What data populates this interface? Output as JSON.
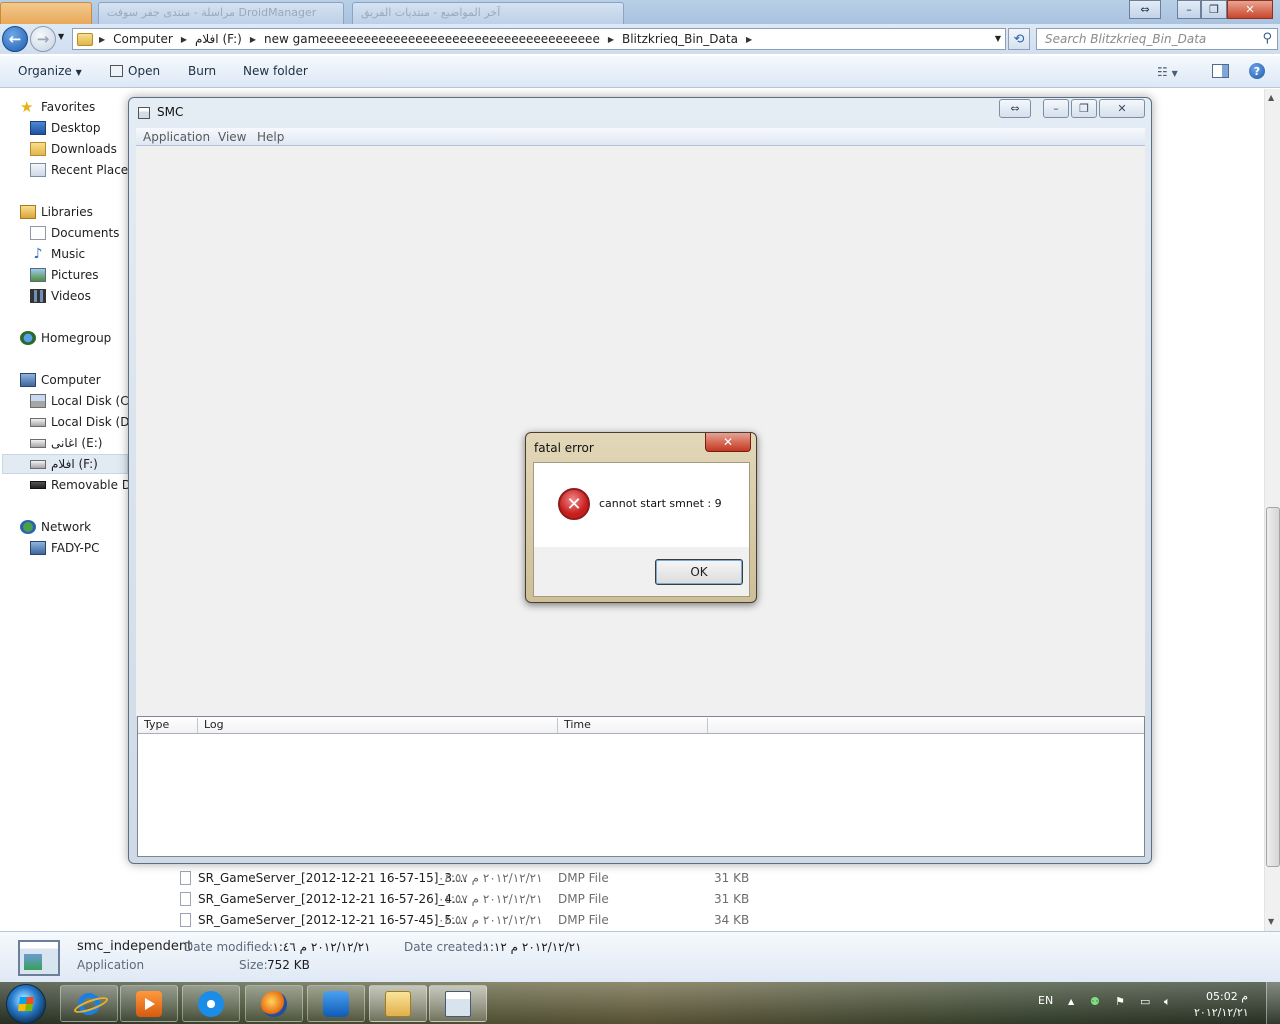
{
  "explorer": {
    "background_tabs": [
      "",
      "مراسلة - منتدى جفر سوفت DroidManager",
      "آخر المواضيع - منتديات الفريق"
    ],
    "address": {
      "segments": [
        "Computer",
        "افلام (F:)",
        "new gameeeeeeeeeeeeeeeeeeeeeeeeeeeeeeeeeeeeee",
        "Blitzkrieq_Bin_Data"
      ]
    },
    "search_placeholder": "Search Blitzkrieq_Bin_Data",
    "toolbar": {
      "organize": "Organize",
      "open": "Open",
      "burn": "Burn",
      "new_folder": "New folder"
    },
    "nav": {
      "favorites": "Favorites",
      "desktop": "Desktop",
      "downloads": "Downloads",
      "recent_places": "Recent Places",
      "libraries": "Libraries",
      "documents": "Documents",
      "music": "Music",
      "pictures": "Pictures",
      "videos": "Videos",
      "homegroup": "Homegroup",
      "computer": "Computer",
      "local_c": "Local Disk (C:)",
      "local_d": "Local Disk (D:)",
      "drive_e": "اغانى (E:)",
      "drive_f": "افلام (F:)",
      "removable": "Removable Disk",
      "network": "Network",
      "fady_pc": "FADY-PC"
    },
    "files": [
      {
        "name": "SR_GameServer_[2012-12-21 16-57-15]_3....",
        "date": "٢٠١٢/١٢/٢١ م ٠٤:٥٧",
        "type": "DMP File",
        "size": "31 KB"
      },
      {
        "name": "SR_GameServer_[2012-12-21 16-57-26]_4....",
        "date": "٢٠١٢/١٢/٢١ م ٠٤:٥٧",
        "type": "DMP File",
        "size": "31 KB"
      },
      {
        "name": "SR_GameServer_[2012-12-21 16-57-45]_5....",
        "date": "٢٠١٢/١٢/٢١ م ٠٤:٥٧",
        "type": "DMP File",
        "size": "34 KB"
      }
    ],
    "details": {
      "name": "smc_independent",
      "kind": "Application",
      "date_modified_label": "Date modified:",
      "date_modified": "٢٠١٢/١٢/٢١ م ٠١:٤٦",
      "date_created_label": "Date created:",
      "date_created": "٢٠١٢/١٢/٢١ م ٠١:١٢",
      "size_label": "Size:",
      "size": "752 KB"
    }
  },
  "smc": {
    "title": "SMC",
    "menu": [
      "Application",
      "View",
      "Help"
    ],
    "log_columns": [
      "Type",
      "Log",
      "Time"
    ]
  },
  "dialog": {
    "title": "fatal error",
    "message": "cannot start smnet : 9",
    "ok": "OK",
    "close": "✕"
  },
  "taskbar": {
    "language": "EN",
    "time": "05:02 م",
    "date": "٢٠١٢/١٢/٢١"
  },
  "icons": {
    "back": "back-arrow-icon",
    "forward": "forward-arrow-icon",
    "refresh": "refresh-icon",
    "search": "search-icon",
    "error": "error-x-icon",
    "help": "help-icon"
  },
  "colors": {
    "titlebar_glass": "#cfdae6",
    "dialog_glass": "#cdbf98",
    "close_red": "#c4381f",
    "error_red": "#c81d1d"
  }
}
